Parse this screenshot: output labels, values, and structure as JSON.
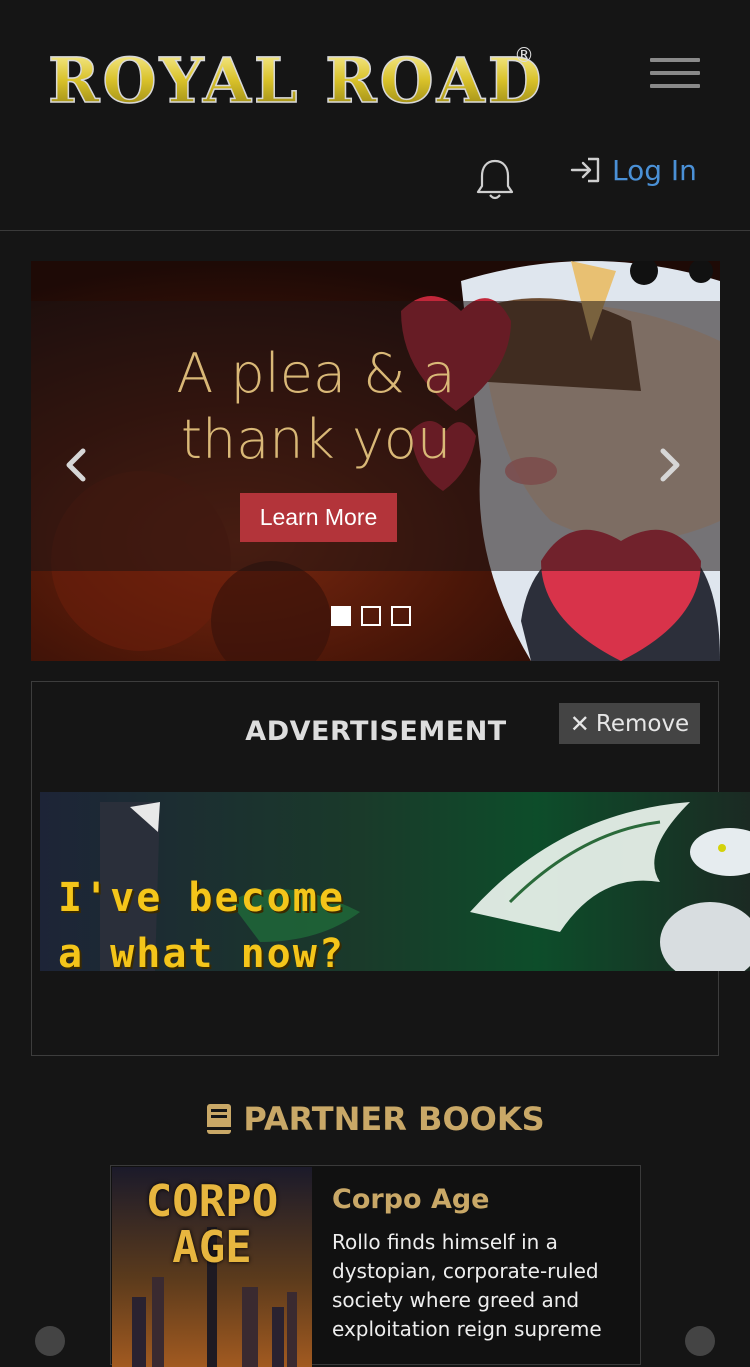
{
  "header": {
    "brand": "ROYAL ROAD",
    "registered_mark": "®",
    "login_label": "Log In"
  },
  "carousel": {
    "slide_title": "A plea & a thank you",
    "cta_label": "Learn More",
    "indicators": [
      true,
      false,
      false
    ]
  },
  "ad": {
    "label": "ADVERTISEMENT",
    "remove_label": "Remove",
    "banner_line1": "I've become",
    "banner_line2": "a what now?"
  },
  "partner": {
    "heading": "PARTNER BOOKS",
    "book": {
      "cover_text_1": "CORPO",
      "cover_text_2": "AGE",
      "title": "Corpo Age",
      "description": "Rollo finds himself in a dystopian, corporate-ruled society where greed and exploitation reign supreme"
    }
  },
  "colors": {
    "background": "#151515",
    "accent_gold": "#c9a867",
    "link_blue": "#4a90d6",
    "button_red": "#b3343a"
  }
}
